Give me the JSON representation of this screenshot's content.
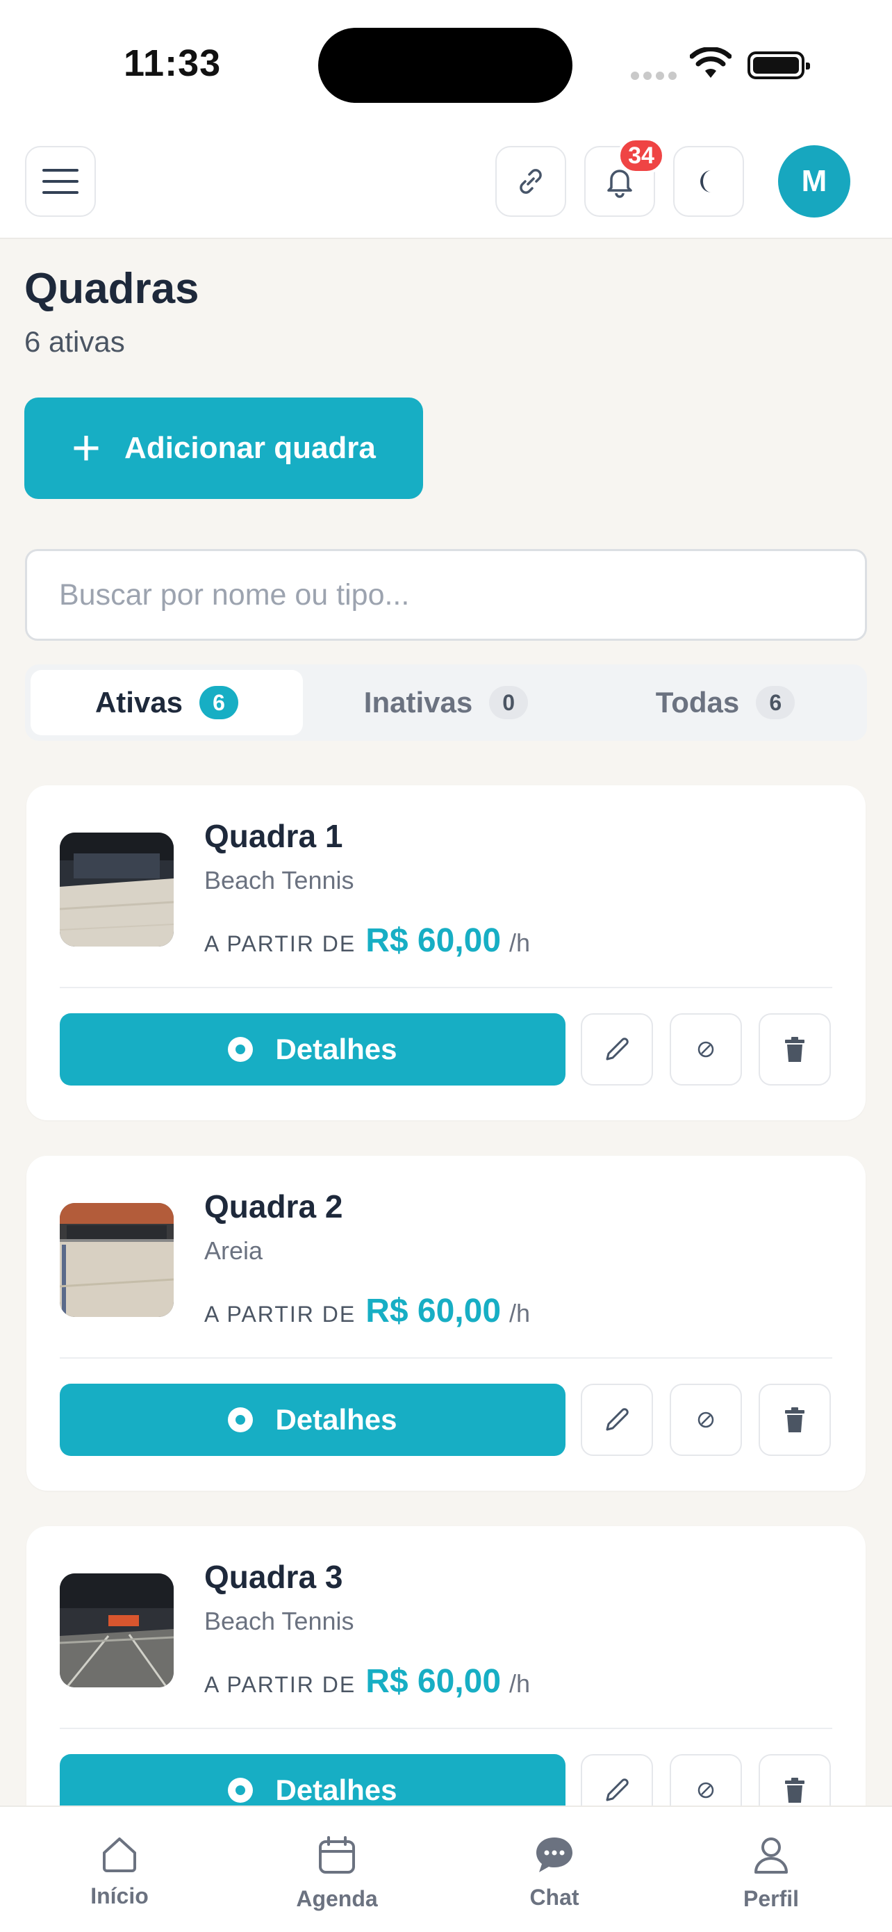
{
  "status": {
    "time": "11:33"
  },
  "header": {
    "notification_count": "34",
    "avatar_initial": "M"
  },
  "page": {
    "title": "Quadras",
    "subtitle": "6 ativas"
  },
  "add_button": {
    "label": "Adicionar quadra"
  },
  "search": {
    "placeholder": "Buscar por nome ou tipo..."
  },
  "tabs": [
    {
      "label": "Ativas",
      "count": "6"
    },
    {
      "label": "Inativas",
      "count": "0"
    },
    {
      "label": "Todas",
      "count": "6"
    }
  ],
  "courts": [
    {
      "name": "Quadra 1",
      "type": "Beach Tennis",
      "price_prefix": "A PARTIR DE",
      "price": "R$ 60,00",
      "unit": "/h",
      "details_label": "Detalhes"
    },
    {
      "name": "Quadra 2",
      "type": "Areia",
      "price_prefix": "A PARTIR DE",
      "price": "R$ 60,00",
      "unit": "/h",
      "details_label": "Detalhes"
    },
    {
      "name": "Quadra 3",
      "type": "Beach Tennis",
      "price_prefix": "A PARTIR DE",
      "price": "R$ 60,00",
      "unit": "/h",
      "details_label": "Detalhes"
    }
  ],
  "bottom_nav": [
    {
      "label": "Início",
      "icon": "home-icon"
    },
    {
      "label": "Agenda",
      "icon": "calendar-icon"
    },
    {
      "label": "Chat",
      "icon": "chat-icon"
    },
    {
      "label": "Perfil",
      "icon": "user-icon"
    }
  ],
  "colors": {
    "accent": "#17aec4",
    "badge": "#ef4444",
    "background": "#f7f5f1"
  }
}
